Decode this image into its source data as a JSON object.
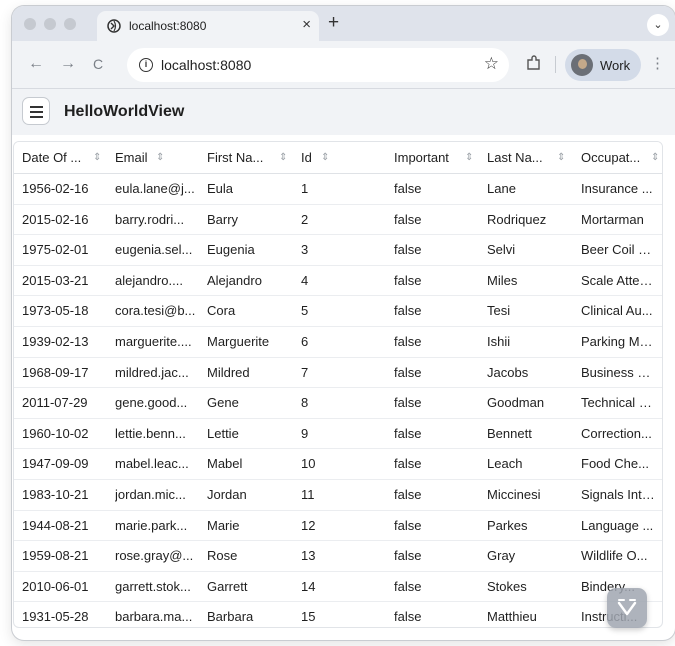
{
  "browser": {
    "tab_title": "localhost:8080",
    "tab_close": "×",
    "new_tab": "+",
    "tab_menu": "⌄",
    "back": "←",
    "forward": "→",
    "reload": "C",
    "url": "localhost:8080",
    "info_icon": "i",
    "star": "☆",
    "profile_label": "Work",
    "menu": "⋮"
  },
  "app": {
    "title": "HelloWorldView"
  },
  "grid": {
    "columns": [
      {
        "label": "Date Of ...",
        "sortable": true
      },
      {
        "label": "Email",
        "sortable": true
      },
      {
        "label": "First Na...",
        "sortable": true
      },
      {
        "label": "Id",
        "sortable": true
      },
      {
        "label": "Important",
        "sortable": true
      },
      {
        "label": "Last Na...",
        "sortable": true
      },
      {
        "label": "Occupat...",
        "sortable": true
      }
    ],
    "sort_glyph": "⇕",
    "rows": [
      [
        "1956-02-16",
        "eula.lane@j...",
        "Eula",
        "1",
        "false",
        "Lane",
        "Insurance ..."
      ],
      [
        "2015-02-16",
        "barry.rodri...",
        "Barry",
        "2",
        "false",
        "Rodriquez",
        "Mortarman"
      ],
      [
        "1975-02-01",
        "eugenia.sel...",
        "Eugenia",
        "3",
        "false",
        "Selvi",
        "Beer Coil Cl..."
      ],
      [
        "2015-03-21",
        "alejandro....",
        "Alejandro",
        "4",
        "false",
        "Miles",
        "Scale Atten..."
      ],
      [
        "1973-05-18",
        "cora.tesi@b...",
        "Cora",
        "5",
        "false",
        "Tesi",
        "Clinical Au..."
      ],
      [
        "1939-02-13",
        "marguerite....",
        "Marguerite",
        "6",
        "false",
        "Ishii",
        "Parking Me..."
      ],
      [
        "1968-09-17",
        "mildred.jac...",
        "Mildred",
        "7",
        "false",
        "Jacobs",
        "Business U..."
      ],
      [
        "2011-07-29",
        "gene.good...",
        "Gene",
        "8",
        "false",
        "Goodman",
        "Technical C..."
      ],
      [
        "1960-10-02",
        "lettie.benn...",
        "Lettie",
        "9",
        "false",
        "Bennett",
        "Correction..."
      ],
      [
        "1947-09-09",
        "mabel.leac...",
        "Mabel",
        "10",
        "false",
        "Leach",
        "Food Che..."
      ],
      [
        "1983-10-21",
        "jordan.mic...",
        "Jordan",
        "11",
        "false",
        "Miccinesi",
        "Signals Inte..."
      ],
      [
        "1944-08-21",
        "marie.park...",
        "Marie",
        "12",
        "false",
        "Parkes",
        "Language ..."
      ],
      [
        "1959-08-21",
        "rose.gray@...",
        "Rose",
        "13",
        "false",
        "Gray",
        "Wildlife O..."
      ],
      [
        "2010-06-01",
        "garrett.stok...",
        "Garrett",
        "14",
        "false",
        "Stokes",
        "Bindery..."
      ],
      [
        "1931-05-28",
        "barbara.ma...",
        "Barbara",
        "15",
        "false",
        "Matthieu",
        "Instructi..."
      ]
    ]
  },
  "icons": {
    "favicon": "globe-icon",
    "extensions": "puzzle-icon",
    "drawer": "hamburger-icon",
    "dev_tools": "vaadin-logo-icon"
  }
}
